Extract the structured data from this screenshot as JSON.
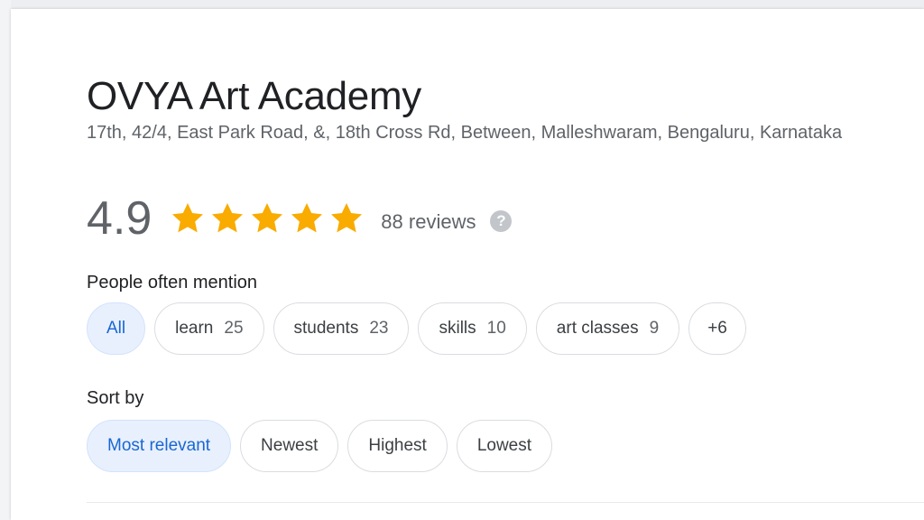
{
  "place": {
    "name": "OVYA Art Academy",
    "address": "17th, 42/4, East Park Road, &, 18th Cross Rd, Between, Malleshwaram, Bengaluru, Karnataka"
  },
  "rating": {
    "value": "4.9",
    "stars": 5,
    "star_color": "#f9ab00",
    "reviews_text": "88 reviews",
    "help_icon": "?"
  },
  "mentions": {
    "label": "People often mention",
    "chips": [
      {
        "label": "All",
        "count": "",
        "selected": true
      },
      {
        "label": "learn",
        "count": "25",
        "selected": false
      },
      {
        "label": "students",
        "count": "23",
        "selected": false
      },
      {
        "label": "skills",
        "count": "10",
        "selected": false
      },
      {
        "label": "art classes",
        "count": "9",
        "selected": false
      },
      {
        "label": "+6",
        "count": "",
        "selected": false
      }
    ]
  },
  "sort": {
    "label": "Sort by",
    "options": [
      {
        "label": "Most relevant",
        "selected": true
      },
      {
        "label": "Newest",
        "selected": false
      },
      {
        "label": "Highest",
        "selected": false
      },
      {
        "label": "Lowest",
        "selected": false
      }
    ]
  },
  "colors": {
    "selected_bg": "#e8f0fe",
    "selected_text": "#1967d2"
  }
}
